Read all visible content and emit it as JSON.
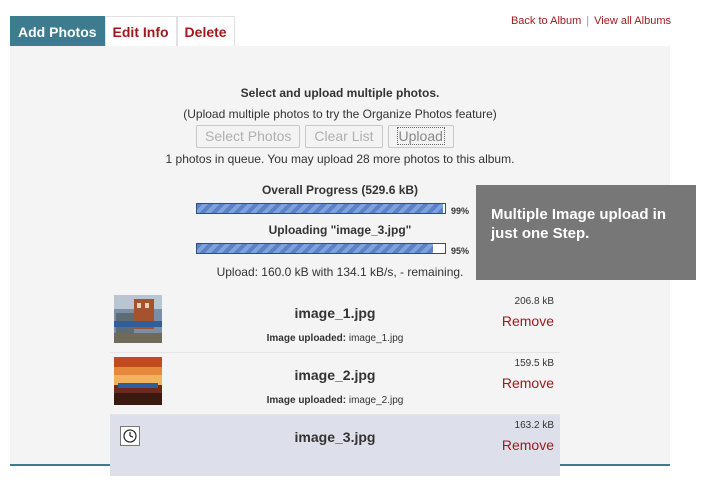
{
  "tabs": [
    {
      "label": "Add Photos",
      "active": true
    },
    {
      "label": "Edit Info",
      "active": false
    },
    {
      "label": "Delete",
      "active": false
    }
  ],
  "top_links": {
    "back": "Back to Album",
    "separator": "|",
    "view_all": "View all Albums"
  },
  "upload": {
    "title": "Select and upload multiple photos.",
    "subtitle": "(Upload multiple photos to try the Organize Photos feature)",
    "buttons": {
      "select": "Select Photos",
      "clear": "Clear List",
      "upload": "Upload"
    },
    "queue_text": "1 photos in queue. You may upload 28 more photos to this album.",
    "overall_label": "Overall Progress (529.6 kB)",
    "overall_percent_text": "99%",
    "overall_percent": 99,
    "current_label": "Uploading \"image_3.jpg\"",
    "current_percent_text": "95%",
    "current_percent": 95,
    "rate_text": "Upload: 160.0 kB with 134.1 kB/s, - remaining."
  },
  "files": [
    {
      "name": "image_1.jpg",
      "size": "206.8 kB",
      "remove": "Remove",
      "status_label": "Image uploaded:",
      "status_value": "image_1.jpg"
    },
    {
      "name": "image_2.jpg",
      "size": "159.5 kB",
      "remove": "Remove",
      "status_label": "Image uploaded:",
      "status_value": "image_2.jpg"
    },
    {
      "name": "image_3.jpg",
      "size": "163.2 kB",
      "remove": "Remove"
    }
  ],
  "callout": {
    "text": "Multiple Image upload in just one Step."
  },
  "colors": {
    "accent": "#3c7c8e",
    "link": "#a0191e",
    "callout_bg": "#777777",
    "progress": "#5b82c8"
  }
}
